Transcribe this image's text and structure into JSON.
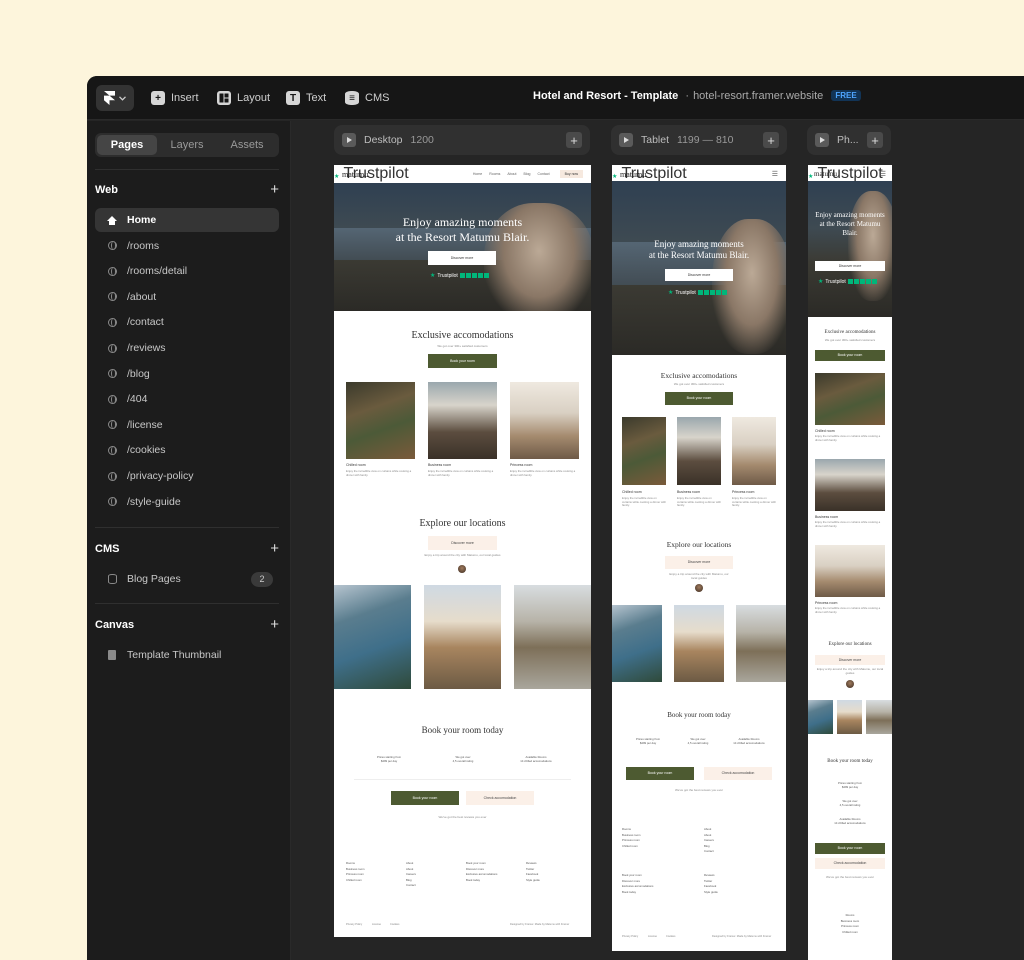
{
  "topbar": {
    "tools": [
      {
        "label": "Insert",
        "icon": "plus-square-icon"
      },
      {
        "label": "Layout",
        "icon": "layout-icon"
      },
      {
        "label": "Text",
        "icon": "text-icon"
      },
      {
        "label": "CMS",
        "icon": "database-icon"
      }
    ],
    "project_name": "Hotel and Resort - Template",
    "separator": "·",
    "project_url": "hotel-resort.framer.website",
    "plan_badge": "FREE"
  },
  "sidebar": {
    "tabs": [
      "Pages",
      "Layers",
      "Assets"
    ],
    "active_tab": "Pages",
    "web": {
      "title": "Web",
      "pages": [
        "Home",
        "/rooms",
        "/rooms/detail",
        "/about",
        "/contact",
        "/reviews",
        "/blog",
        "/404",
        "/license",
        "/cookies",
        "/privacy-policy",
        "/style-guide"
      ]
    },
    "cms": {
      "title": "CMS",
      "item": "Blog Pages",
      "count": "2"
    },
    "canvas": {
      "title": "Canvas",
      "item": "Template Thumbnail"
    }
  },
  "frames": {
    "desktop": {
      "name": "Desktop",
      "size": "1200"
    },
    "tablet": {
      "name": "Tablet",
      "size": "1199 — 810"
    },
    "phone": {
      "name": "Ph..."
    }
  },
  "site": {
    "brand": "matumu",
    "nav_links": [
      "Home",
      "Rooms",
      "About",
      "Blog",
      "Contact"
    ],
    "book_now": "Buy now",
    "hero_title_line1": "Enjoy amazing moments",
    "hero_title_line2": "at the Resort Matumu Blair.",
    "hero_cta": "Discover more",
    "trustpilot": "Trustpilot",
    "acc_title": "Exclusive accomodations",
    "acc_sub": "We got over 300+ satisfied customers",
    "book_room_btn": "Book your room",
    "rooms": [
      {
        "name": "Chilled room",
        "desc": "Enjoy the incredible view on curtains while cooking a dinner with family."
      },
      {
        "name": "Business room",
        "desc": "Enjoy the incredible view on curtains while cooking a dinner with family."
      },
      {
        "name": "Princess room",
        "desc": "Enjoy the incredible view on curtains while cooking a dinner with family."
      }
    ],
    "loc_title": "Explore our locations",
    "loc_btn": "Discover more",
    "loc_note": "Enjoy a trip around the city with Matumu, our local guides",
    "book_title": "Book your room today",
    "stats": [
      {
        "label": "Prices starting from",
        "value": "$499 per day"
      },
      {
        "label": "We got over",
        "value": "4,5 overall rating"
      },
      {
        "label": "Available Rooms",
        "value": "14 chilled accomodations"
      }
    ],
    "check_btn": "Check accomodation",
    "rated_note": "We've got the best reviews you ever",
    "footer_cols": [
      [
        "Rooms",
        "Business room",
        "Princess room",
        "Chilled room"
      ],
      [
        "About",
        "About",
        "Careers",
        "Blog",
        "Contact"
      ],
      [
        "Book your room",
        "Discover more",
        "Exclusive accomodations",
        "Book today"
      ],
      [
        "Reviews",
        "Twitter",
        "Facebook",
        "Style guide"
      ]
    ],
    "footer_bottom": [
      "Privacy Policy",
      "License",
      "Cookies"
    ],
    "copyright": "Designed by Framer. Made by Matumu with Framer"
  }
}
